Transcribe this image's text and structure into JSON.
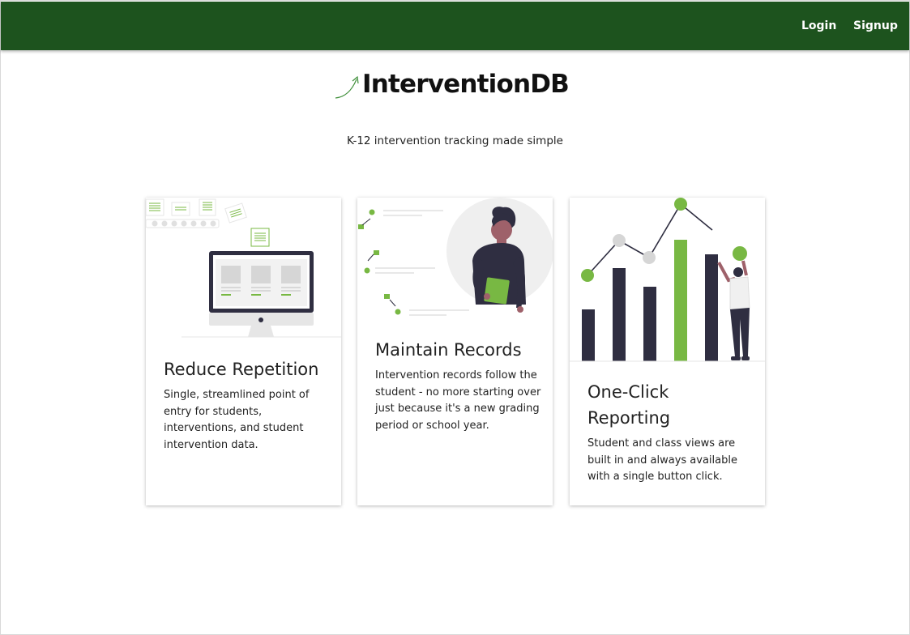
{
  "nav": {
    "login_label": "Login",
    "signup_label": "Signup"
  },
  "brand": {
    "name": "InterventionDB",
    "logo_icon": "upward-arrow-icon"
  },
  "tagline": "K-12 intervention tracking made simple",
  "colors": {
    "navbar": "#1d531e",
    "accent_green": "#78b843",
    "dark_navy": "#2f2e41",
    "light_gray": "#e6e6e6"
  },
  "cards": [
    {
      "illustration": "computer-monitor-illustration",
      "title": "Reduce Repetition",
      "text": "Single, streamlined point of entry for students, interventions, and student intervention data."
    },
    {
      "illustration": "person-holding-folder-illustration",
      "title": "Maintain Records",
      "text": "Intervention records follow the student - no more starting over just because it's a new grading period or school year."
    },
    {
      "illustration": "bar-chart-person-illustration",
      "title": "One-Click Reporting",
      "text": "Student and class views are built in and always available with a single button click."
    }
  ]
}
